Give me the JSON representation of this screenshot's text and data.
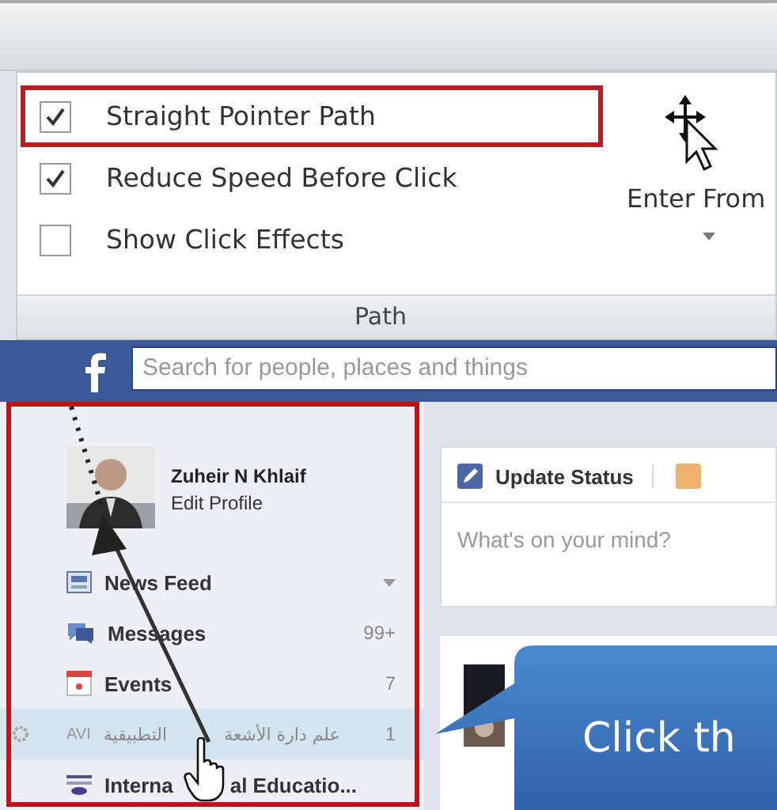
{
  "ribbon": {
    "options": [
      {
        "label": "Straight Pointer Path",
        "checked": true,
        "highlighted": true
      },
      {
        "label": "Reduce Speed Before Click",
        "checked": true,
        "highlighted": false
      },
      {
        "label": "Show Click Effects",
        "checked": false,
        "highlighted": false
      }
    ],
    "enter_button": {
      "label": "Enter From"
    },
    "group_label": "Path"
  },
  "search": {
    "placeholder": "Search for people, places and things"
  },
  "profile": {
    "name": "Zuheir N Khlaif",
    "link": "Edit Profile"
  },
  "nav": [
    {
      "kind": "news",
      "label": "News Feed",
      "caret": true,
      "selected": false
    },
    {
      "kind": "messages",
      "label": "Messages",
      "count": "99+",
      "caret": false,
      "selected": false
    },
    {
      "kind": "events",
      "label": "Events",
      "count": "7",
      "caret": false,
      "selected": false
    },
    {
      "kind": "group",
      "prefix": "AVI",
      "label_parts": [
        "علم دارة الأشعة",
        "التطبيقية"
      ],
      "count": "1",
      "caret": false,
      "selected": true
    },
    {
      "kind": "page",
      "label_parts": [
        "Interna",
        "al Educatio..."
      ],
      "caret": false,
      "selected": false
    }
  ],
  "composer": {
    "tab": "Update Status",
    "placeholder": "What's on your mind?"
  },
  "callout": {
    "text": "Click th"
  }
}
